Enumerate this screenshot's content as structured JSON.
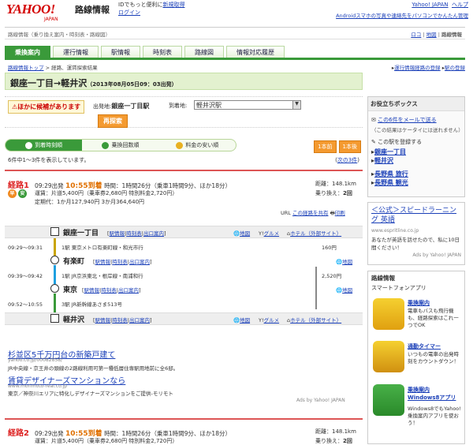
{
  "header": {
    "logo": "YAHOO!",
    "logo_sub": "JAPAN",
    "service": "路線情報",
    "promo_line1_prefix": "IDでもっと便利に",
    "promo_register": "新規取得",
    "promo_login": "ログイン",
    "yahoo_japan": "Yahoo! JAPAN",
    "help": "ヘルプ",
    "android_promo": "Androidスマホの写真や連絡先をパソコンでかんたん管理"
  },
  "subheader": {
    "desc": "路線情報（乗り換え案内・時刻表・路線図）",
    "right_links": [
      "ロコ",
      "地図",
      "路線情報"
    ]
  },
  "tabs": [
    "乗換案内",
    "運行情報",
    "駅情報",
    "時刻表",
    "路線図",
    "情報対応履歴"
  ],
  "breadcrumb": {
    "top": "路線情報トップ",
    "current": "経路、運賃探索結果",
    "right_links": [
      "運行情報経路の登録",
      "駅の登録"
    ]
  },
  "route_title": {
    "text": "銀座一丁目→軽井沢",
    "datetime": "（2013年08月05日09：03出発）"
  },
  "alternatives": {
    "badge": "ほかに候補があります",
    "from_label": "出発地:",
    "from_value": "銀座一丁目駅",
    "to_label": "到着地:",
    "to_value": "軽井沢駅",
    "research": "再探索"
  },
  "sort_tabs": [
    "到着時刻順",
    "乗換回数順",
    "料金の安い順"
  ],
  "page_buttons": [
    "1本前",
    "1本後"
  ],
  "count_text": "6件中1〜3件を表示しています。",
  "next_link": "次の3件",
  "route1": {
    "label": "経路1",
    "depart": "09:29出発",
    "arrive": "10:55到着",
    "time": "時間：1時間26分（乗車1時間9分、ほか18分）",
    "fare": "運賃：片道5,400円（乗車券2,680円 特別料金2,720円）",
    "pass": "定期代：1か月127,940円 3か月364,640円",
    "distance_label": "距離：",
    "distance": "148.1km",
    "transfers_label": "乗り換え：",
    "transfers": "2回",
    "url_label": "この経路を共有",
    "print": "印刷",
    "icons": [
      "早",
      "安"
    ]
  },
  "timeline": {
    "station_links": [
      "駅情報",
      "時刻表",
      "出口案内"
    ],
    "map": "地図",
    "gourmet": "グルメ",
    "hotel": "ホテル（外部サイト）",
    "stations": [
      "銀座一丁目",
      "有楽町",
      "東京",
      "軽井沢"
    ],
    "legs": [
      {
        "time": "09:29〜09:31",
        "desc": "1駅 東京メトロ有楽町線・和光市行",
        "fare": "160円"
      },
      {
        "time": "09:39〜09:42",
        "desc": "1駅 JR京浜東北・根岸線・南浦和行",
        "fare": "2,520円"
      },
      {
        "time": "09:52〜10:55",
        "desc": "3駅 JR新幹線あさま513号",
        "fare": ""
      }
    ]
  },
  "ads": [
    {
      "title": "杉並区5千万円台の新築戸建て",
      "url": "yahoo.co.jp/00082858/",
      "text": "JR中央線・京王井の頭線の2路線利用可第一種低層住専駅用地前に全6邸。"
    },
    {
      "title": "賃貸デザイナーズマンションなら",
      "url": "www.morimoto-real.co.jp",
      "text": "東京／神奈川エリアに特化しデザイナーズマンションをご提供-モリモト"
    }
  ],
  "ads_by": "Ads by Yahoo! JAPAN",
  "route2": {
    "label": "経路2",
    "depart": "09:29出発",
    "arrive": "10:55到着",
    "time": "時間：1時間26分（乗車1時間9分、ほか18分）",
    "fare": "運賃：片道5,400円（乗車券2,680円 特別料金2,720円）",
    "distance_label": "距離：",
    "distance": "148.1km",
    "transfers_label": "乗り換え：",
    "transfers": "2回"
  },
  "sidebar": {
    "box_title": "お役立ちボックス",
    "mail_link": "この6件をメールで送る",
    "mail_note": "（この結果はケータイには送れません）",
    "register_head": "この駅を登録する",
    "stations": [
      "銀座一丁目",
      "軽井沢"
    ],
    "nagano": [
      "長野県 旅行",
      "長野県 観光"
    ],
    "ad_title": "＜公式＞スピードラーニング 英語",
    "ad_url": "www.espritline.co.jp",
    "ad_text": "あなたが英語を話せたので、私に10日間ください！",
    "ad_by": "Ads by Yahoo! JAPAN",
    "apps_title": "路線情報",
    "apps_sub": "スマートフォンアプリ",
    "apps": [
      {
        "title": "乗換案内",
        "desc": "電車もバスも飛行機も、経路探索はこれ一つでOK"
      },
      {
        "title": "通勤タイマー",
        "desc": "いつもの電車の出発時刻をカウントダウン！"
      },
      {
        "title": "乗換案内 Windows8アプリ",
        "desc": "Windows8でもYahoo!乗換案内アプリを使おう！"
      }
    ]
  }
}
